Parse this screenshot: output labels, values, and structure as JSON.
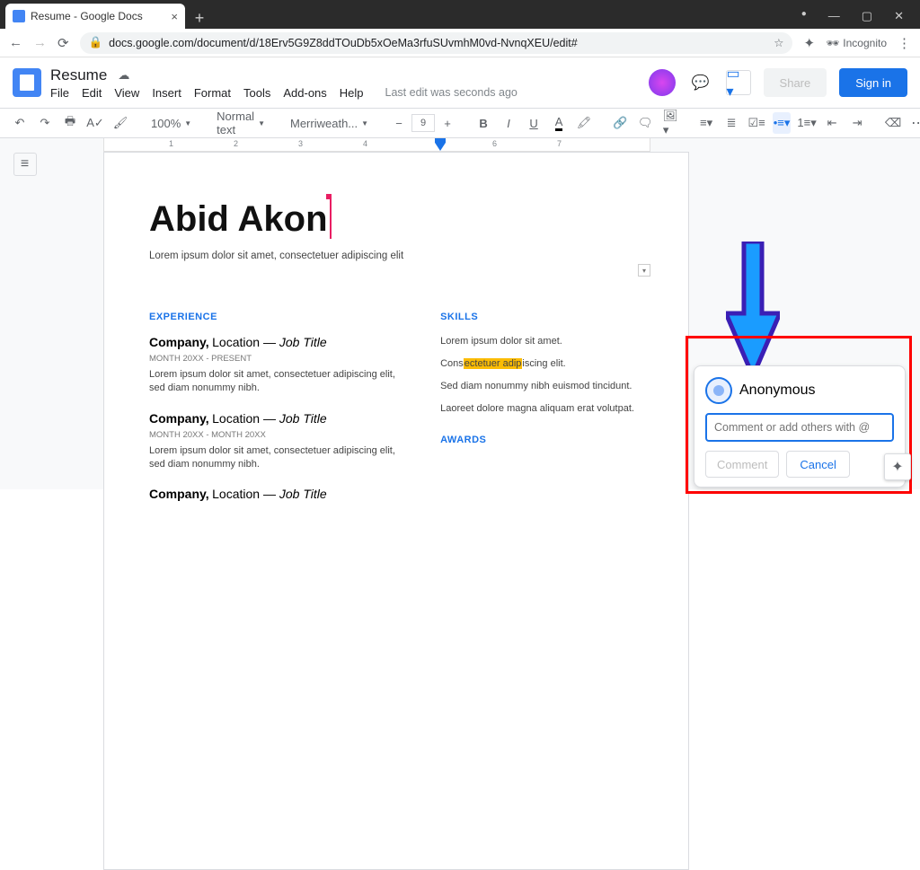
{
  "browser": {
    "tab_title": "Resume - Google Docs",
    "url": "docs.google.com/document/d/18Erv5G9Z8ddTOuDb5xOeMa3rfuSUvmhM0vd-NvnqXEU/edit#",
    "incognito_label": "Incognito"
  },
  "header": {
    "doc_title": "Resume",
    "menus": [
      "File",
      "Edit",
      "View",
      "Insert",
      "Format",
      "Tools",
      "Add-ons",
      "Help"
    ],
    "last_edit": "Last edit was seconds ago",
    "share_label": "Share",
    "signin_label": "Sign in"
  },
  "toolbar": {
    "zoom": "100%",
    "style": "Normal text",
    "font": "Merriweath...",
    "font_size": "9"
  },
  "ruler": {
    "marks": [
      "1",
      "2",
      "3",
      "4",
      "6",
      "7"
    ]
  },
  "doc": {
    "name": "Abid Akon",
    "tagline": "Lorem ipsum dolor sit amet, consectetuer adipiscing elit",
    "left": {
      "heading": "EXPERIENCE",
      "jobs": [
        {
          "company": "Company,",
          "location": "Location",
          "dash": " — ",
          "title": "Job Title",
          "dates": "MONTH 20XX - PRESENT",
          "desc": "Lorem ipsum dolor sit amet, consectetuer adipiscing elit, sed diam nonummy nibh."
        },
        {
          "company": "Company,",
          "location": "Location",
          "dash": " — ",
          "title": "Job Title",
          "dates": "MONTH 20XX - MONTH 20XX",
          "desc": "Lorem ipsum dolor sit amet, consectetuer adipiscing elit, sed diam nonummy nibh."
        },
        {
          "company": "Company,",
          "location": "Location",
          "dash": " — ",
          "title": "Job Title"
        }
      ]
    },
    "right": {
      "skills_heading": "SKILLS",
      "skills": [
        "Lorem ipsum dolor sit amet.",
        {
          "pre": "Cons",
          "hl": "ectetuer adip",
          "post": "iscing elit."
        },
        "Sed diam nonummy nibh euismod tincidunt.",
        "Laoreet dolore magna aliquam erat volutpat."
      ],
      "awards_heading": "AWARDS"
    }
  },
  "comment": {
    "author": "Anonymous",
    "placeholder": "Comment or add others with @",
    "submit": "Comment",
    "cancel": "Cancel"
  }
}
